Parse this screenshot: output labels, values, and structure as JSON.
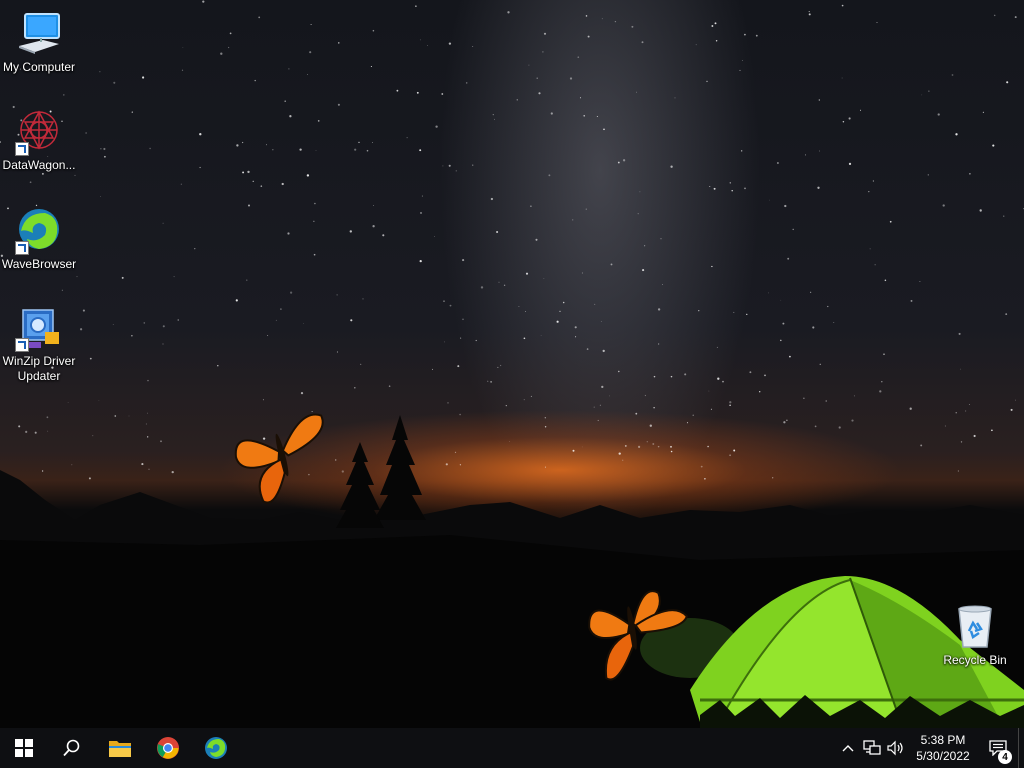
{
  "desktop": {
    "icons": [
      {
        "label": "My Computer",
        "icon": "computer-icon",
        "shortcut": false
      },
      {
        "label": "DataWagon...",
        "icon": "datawagon-icon",
        "shortcut": true
      },
      {
        "label": "WaveBrowser",
        "icon": "wavebrowser-icon",
        "shortcut": true
      },
      {
        "label": "WinZip Driver Updater",
        "icon": "winzip-driver-updater-icon",
        "shortcut": true
      },
      {
        "label": "Recycle Bin",
        "icon": "recycle-bin-icon",
        "shortcut": false
      }
    ],
    "wallpaper": "night-sky-camping-tent"
  },
  "taskbar": {
    "pinned": [
      {
        "name": "start",
        "icon": "windows-start-icon"
      },
      {
        "name": "search",
        "icon": "search-icon"
      },
      {
        "name": "file-explorer",
        "icon": "folder-icon"
      },
      {
        "name": "chrome",
        "icon": "chrome-icon"
      },
      {
        "name": "wavebrowser",
        "icon": "wavebrowser-icon"
      }
    ],
    "tray": {
      "icons": [
        "chevron-up-icon",
        "network-icon",
        "volume-icon"
      ],
      "time": "5:38 PM",
      "date": "5/30/2022",
      "notification_count": "4"
    }
  },
  "colors": {
    "taskbar_bg": "#0e0f12",
    "tent_green": "#7fd21f",
    "horizon_orange": "#e0701e",
    "butterfly_orange": "#f07a12"
  }
}
